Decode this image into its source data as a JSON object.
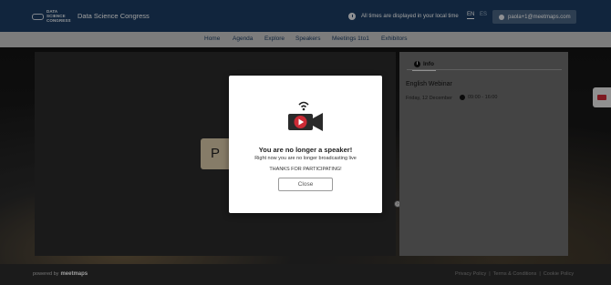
{
  "header": {
    "logo_lines": [
      "DATA",
      "SCIENCE",
      "CONGRESS"
    ],
    "event_title": "Data Science Congress",
    "timezone_note": "All times are displayed in your local time",
    "languages": {
      "active": "EN",
      "other": "ES"
    },
    "user_email": "paola+1@meetmaps.com",
    "colors": {
      "header_bg": "#1c3d63",
      "accent": "#cc2b36"
    }
  },
  "nav": {
    "items": [
      "Home",
      "Agenda",
      "Explore",
      "Speakers",
      "Meetings 1to1",
      "Exhibitors"
    ]
  },
  "stage": {
    "avatar_initial": "P"
  },
  "info_panel": {
    "tab_label": "Info",
    "session_title": "English Webinar",
    "date": "Friday, 12 December",
    "time": "09:00 - 16:00"
  },
  "modal": {
    "icon": "video-camera-broadcast-icon",
    "heading": "You are no longer a speaker!",
    "subtext": "Right now you are no longer broadcasting live",
    "thanks": "THANKS FOR PARTICIPATING!",
    "close_label": "Close"
  },
  "footer": {
    "powered_by": "powered by",
    "brand": "meetmaps",
    "links": [
      "Privacy Policy",
      "Terms & Conditions",
      "Cookie Policy"
    ]
  }
}
